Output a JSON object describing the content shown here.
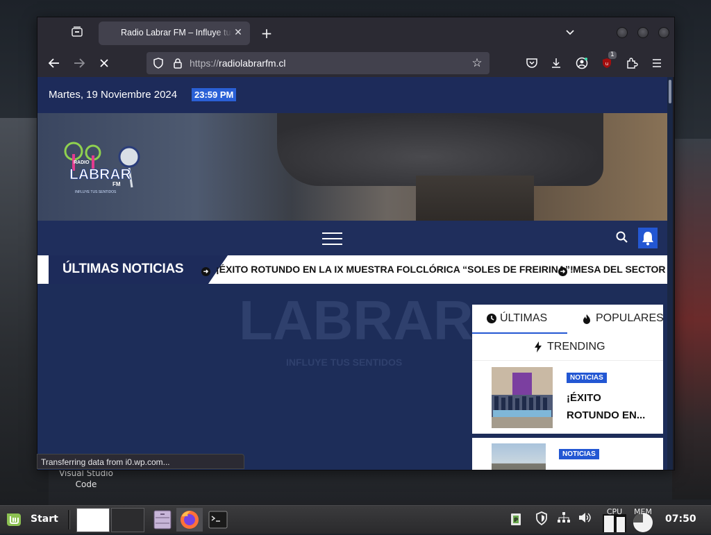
{
  "desktop": {
    "icon_label_line1": "Visual Studio",
    "icon_label_line2": "Code"
  },
  "browser": {
    "tab_title": "Radio Labrar FM – Influye tus sentidos",
    "url_proto": "https://",
    "url_host": "radiolabrarfm.cl",
    "status_text": "Transferring data from i0.wp.com...",
    "extension_badge": "1"
  },
  "site": {
    "date": "Martes, 19 Noviembre 2024",
    "time": "23:59 PM",
    "ticker_label": "ÚLTIMAS NOTICIAS",
    "ticker_items": [
      "¡ÉXITO ROTUNDO EN LA IX MUESTRA FOLCLÓRICA “SOLES DE FREIRINA”!",
      "MESA DEL SECTOR P"
    ],
    "sidebar": {
      "tab_latest": "ÚLTIMAS",
      "tab_popular": "POPULARES",
      "tab_trending": "TRENDING",
      "items": [
        {
          "category": "NOTICIAS",
          "title": "¡ÉXITO ROTUNDO EN..."
        },
        {
          "category": "NOTICIAS"
        }
      ]
    },
    "logo": {
      "text_main": "LABRAR",
      "text_top": "RADIO",
      "text_fm": "FM",
      "tagline": "INFLUYE TUS SENTIDOS"
    }
  },
  "taskbar": {
    "start_label": "Start",
    "cpu_label": "CPU",
    "mem_label": "MEM",
    "clock": "07:50"
  },
  "colors": {
    "site_navy": "#1d2b5a",
    "site_accent": "#2357d3",
    "browser_chrome": "#2b2a33"
  }
}
